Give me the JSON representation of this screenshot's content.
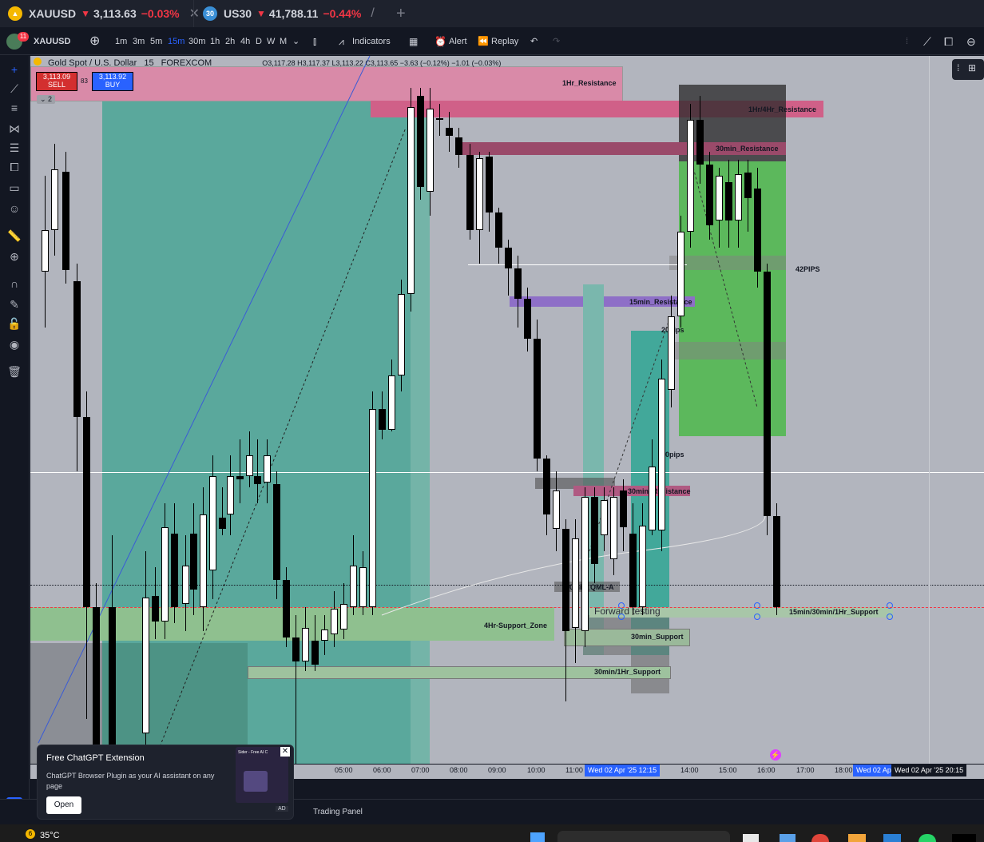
{
  "tabs": [
    {
      "symbol": "XAUUSD",
      "arrow": "▼",
      "price": "3,113.63",
      "change": "−0.03%",
      "close": "✕"
    },
    {
      "badge": "30",
      "symbol": "US30",
      "arrow": "▼",
      "price": "41,788.11",
      "change": "−0.44%",
      "close": "/"
    }
  ],
  "new_tab": "+",
  "toolbar": {
    "avatar_badge": "11",
    "symbol": "XAUUSD",
    "intervals": [
      "1m",
      "3m",
      "5m",
      "15m",
      "30m",
      "1h",
      "2h",
      "4h",
      "D",
      "W",
      "M"
    ],
    "active_interval": "15m",
    "indicators": "Indicators",
    "alert": "Alert",
    "replay": "Replay"
  },
  "legend": {
    "title": "Gold Spot / U.S. Dollar",
    "interval": "15",
    "source": "FOREXCOM",
    "ohlc": "O3,117.28 H3,117.37 L3,113.22 C3,113.65 −3.63 (−0.12%) −1.01 (−0.03%)",
    "sell_price": "3,113.09",
    "sell_label": "SELL",
    "spread": "83",
    "buy_price": "3,113.92",
    "buy_label": "BUY",
    "collapse": "⌄ 2"
  },
  "zones": {
    "z1hr_res": "1Hr_Resistance",
    "z1hr4hr_res": "1Hr/4Hr_Resistance",
    "z30min_res": "30min_Resistance",
    "z15min_res": "15min_Resistance",
    "z30min_res2": "30min_Resistance",
    "z4hr_sup": "4Hr-Support_Zone",
    "z30min_sup": "30min_Support",
    "z30min1hr_sup": "30min/1Hr_Support",
    "z15_30_1hr_sup": "15min/30min/1Hr_Support",
    "qml": "30min_QML-A",
    "forward": "Forward testing",
    "pips42": "42PIPS",
    "pips20": "20pips",
    "pips50": "50pips"
  },
  "time_axis": {
    "labels": [
      "05:00",
      "06:00",
      "07:00",
      "08:00",
      "09:00",
      "10:00",
      "11:00",
      "14:00",
      "15:00",
      "16:00",
      "17:00",
      "18:00"
    ],
    "badge1": "Wed 02 Apr '25   12:15",
    "badge2": "Wed 02 Apr",
    "badge3": "Wed 02 Apr '25   20:15"
  },
  "bottom": {
    "trading_panel": "Trading Panel"
  },
  "popup": {
    "title": "Free ChatGPT Extension",
    "body": "ChatGPT Browser Plugin as your AI assistant on any page",
    "open": "Open",
    "ad": "AD",
    "thumb": "Sider - Free AI C"
  },
  "taskbar": {
    "weather_badge": "6",
    "temperature": "35°C"
  },
  "colors": {
    "up": "#ffffff",
    "down": "#000000",
    "teal": "#5aa89c",
    "green": "#5cb85c",
    "pink": "#e06792",
    "purple": "#7e57c2",
    "accent": "#2962ff"
  }
}
